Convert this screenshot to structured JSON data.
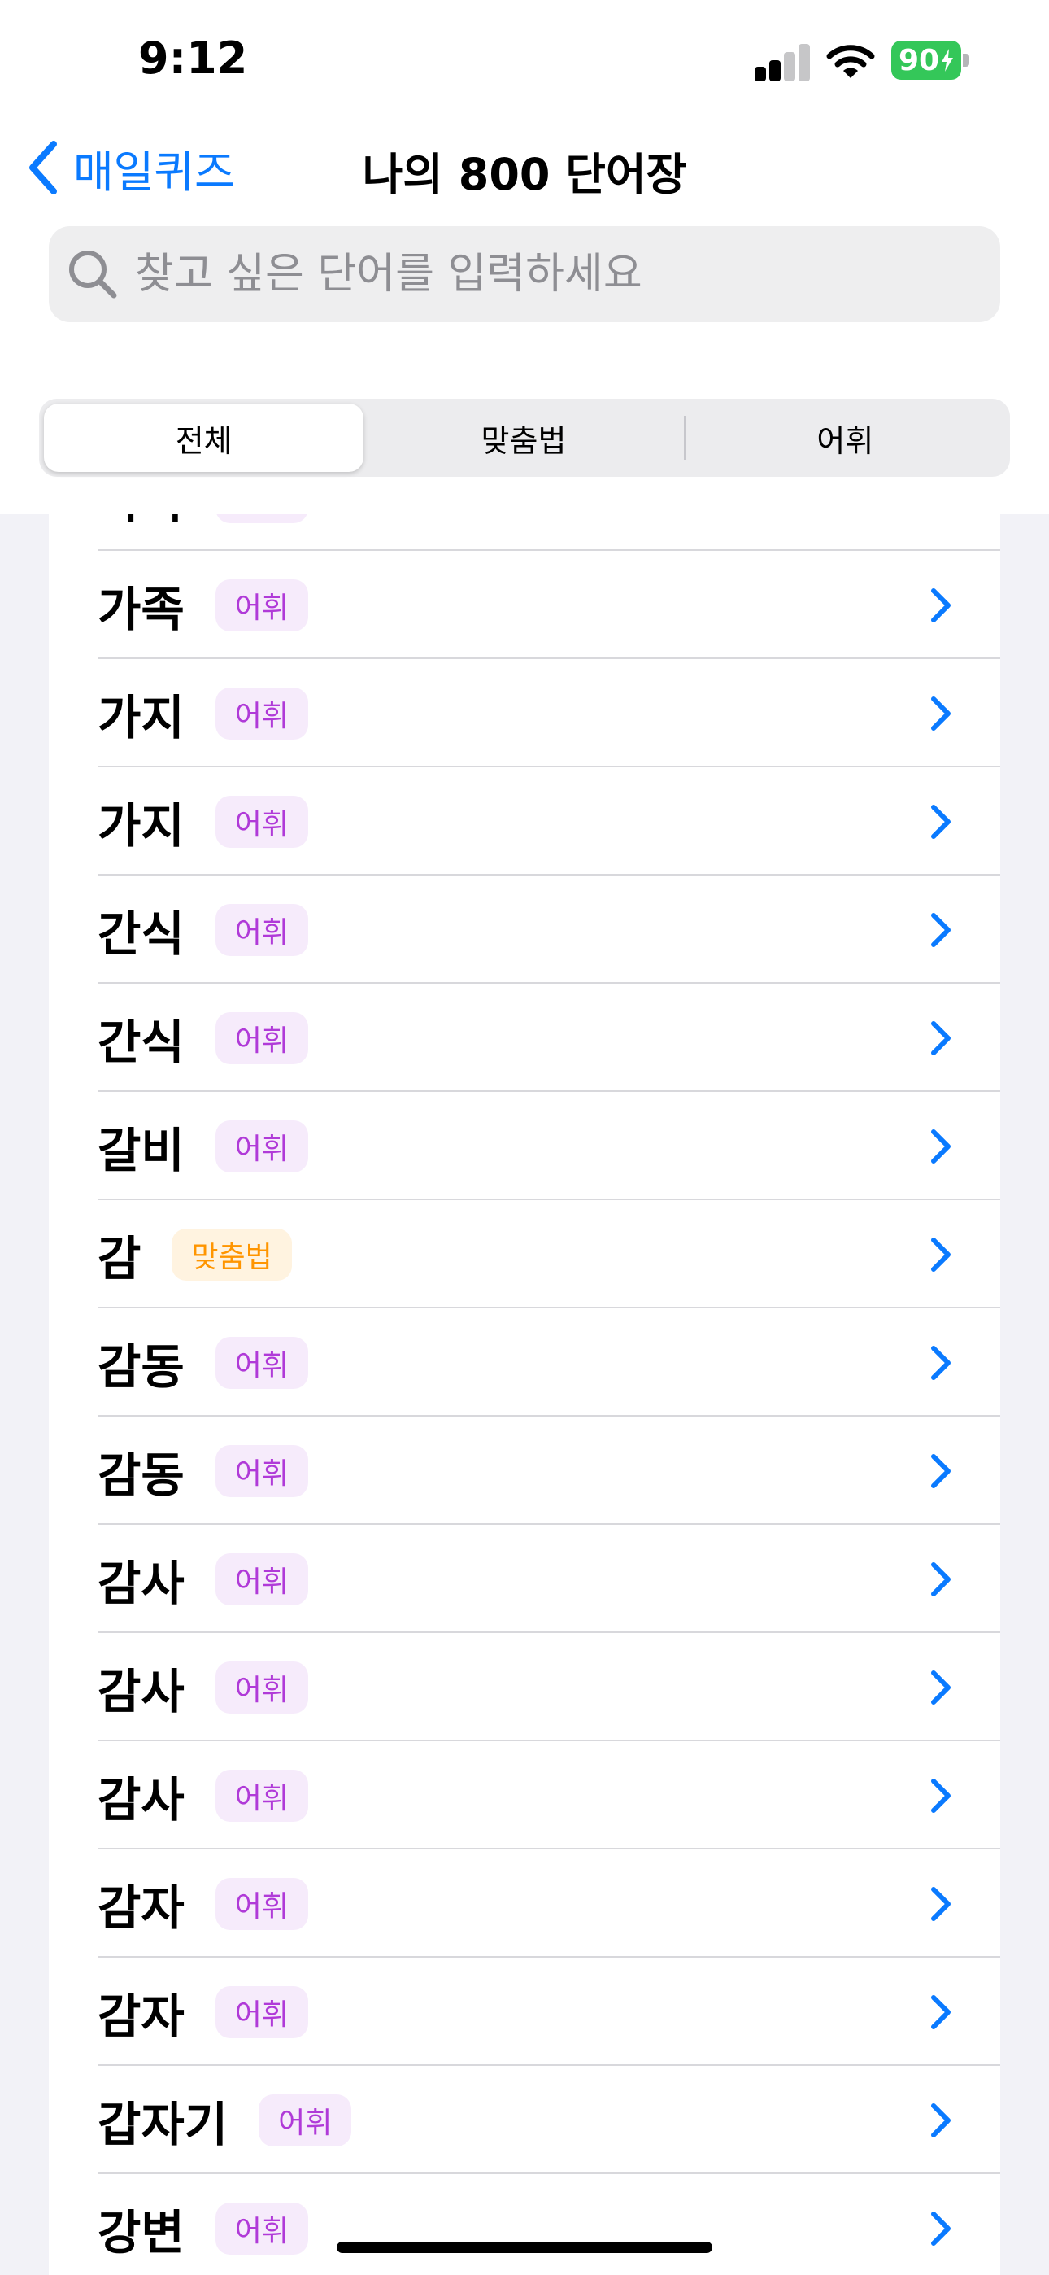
{
  "status": {
    "time": "9:12",
    "battery": "90"
  },
  "nav": {
    "back_label": "매일퀴즈",
    "title": "나의 800 단어장"
  },
  "search": {
    "placeholder": "찾고 싶은 단어를 입력하세요",
    "value": ""
  },
  "segments": [
    {
      "label": "전체",
      "selected": true
    },
    {
      "label": "맞춤법",
      "selected": false
    },
    {
      "label": "어휘",
      "selected": false
    }
  ],
  "list": [
    {
      "word": "가족",
      "tag": "어휘"
    },
    {
      "word": "가족",
      "tag": "어휘"
    },
    {
      "word": "가지",
      "tag": "어휘"
    },
    {
      "word": "가지",
      "tag": "어휘"
    },
    {
      "word": "간식",
      "tag": "어휘"
    },
    {
      "word": "간식",
      "tag": "어휘"
    },
    {
      "word": "갈비",
      "tag": "어휘"
    },
    {
      "word": "감",
      "tag": "맞춤법"
    },
    {
      "word": "감동",
      "tag": "어휘"
    },
    {
      "word": "감동",
      "tag": "어휘"
    },
    {
      "word": "감사",
      "tag": "어휘"
    },
    {
      "word": "감사",
      "tag": "어휘"
    },
    {
      "word": "감사",
      "tag": "어휘"
    },
    {
      "word": "감자",
      "tag": "어휘"
    },
    {
      "word": "감자",
      "tag": "어휘"
    },
    {
      "word": "갑자기",
      "tag": "어휘"
    },
    {
      "word": "강변",
      "tag": "어휘"
    }
  ],
  "colors": {
    "accent": "#0a7aff",
    "vocab_tag": "#b03ad8",
    "spelling_tag": "#ff9500",
    "battery": "#34c759"
  }
}
